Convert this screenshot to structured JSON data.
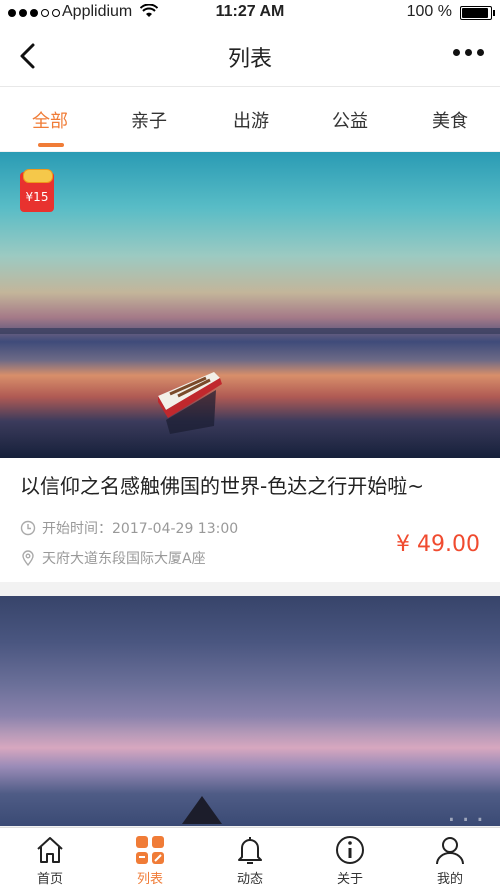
{
  "status_bar": {
    "carrier": "Applidium",
    "time": "11:27 AM",
    "battery": "100 %"
  },
  "nav": {
    "title": "列表"
  },
  "tabs": [
    {
      "label": "全部",
      "active": true
    },
    {
      "label": "亲子",
      "active": false
    },
    {
      "label": "出游",
      "active": false
    },
    {
      "label": "公益",
      "active": false
    },
    {
      "label": "美食",
      "active": false
    }
  ],
  "cards": [
    {
      "badge": "¥15",
      "title": "以信仰之名感触佛国的世界-色达之行开始啦~",
      "start": "开始时间：2017-04-29 13:00",
      "address": "天府大道东段国际大厦A座",
      "price": "¥ 49.00"
    }
  ],
  "tabbar": [
    {
      "label": "首页",
      "icon": "home-icon",
      "active": false
    },
    {
      "label": "列表",
      "icon": "grid-icon",
      "active": true
    },
    {
      "label": "动态",
      "icon": "bell-icon",
      "active": false
    },
    {
      "label": "关于",
      "icon": "info-icon",
      "active": false
    },
    {
      "label": "我的",
      "icon": "user-icon",
      "active": false
    }
  ],
  "colors": {
    "accent": "#f07c37",
    "price": "#f04b2f",
    "badge": "#e8322f"
  }
}
